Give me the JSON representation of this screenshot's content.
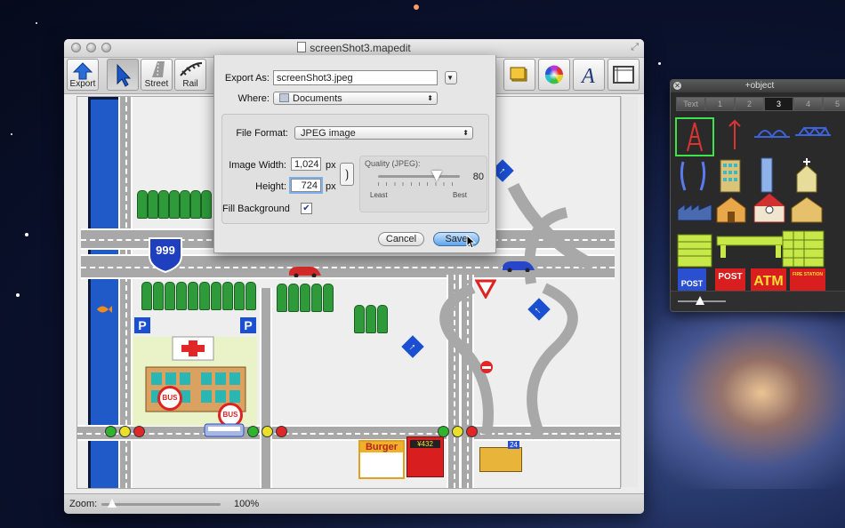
{
  "window": {
    "title": "screenShot3.mapedit"
  },
  "toolbar": {
    "export_label": "Export",
    "street_label": "Street",
    "rail_label": "Rail"
  },
  "export_dialog": {
    "export_as_label": "Export As:",
    "filename": "screenShot3.jpeg",
    "where_label": "Where:",
    "where_value": "Documents",
    "file_format_label": "File Format:",
    "file_format_value": "JPEG image",
    "image_width_label": "Image Width:",
    "image_width_value": "1,024",
    "height_label": "Height:",
    "height_value": "724",
    "unit_px": "px",
    "quality_label": "Quality (JPEG):",
    "quality_value": "80",
    "quality_fraction": 0.72,
    "quality_least": "Least",
    "quality_best": "Best",
    "fill_background_label": "Fill Background",
    "fill_background_checked": true,
    "cancel_label": "Cancel",
    "save_label": "Save"
  },
  "map": {
    "route_sign": "999",
    "parking": "P",
    "bus_stop": "BUS",
    "shops": {
      "burger": "Burger",
      "gas_price": "¥432",
      "convenience": "24"
    }
  },
  "statusbar": {
    "zoom_label": "Zoom:",
    "zoom_value": "100%"
  },
  "palette": {
    "title": "+object",
    "tabs": [
      "Text",
      "1",
      "2",
      "3",
      "4",
      "5"
    ],
    "selected_tab": "3",
    "post_label": "POST",
    "post_label2": "POST",
    "atm_label": "ATM",
    "fire_station_label": "FIRE STATION"
  }
}
